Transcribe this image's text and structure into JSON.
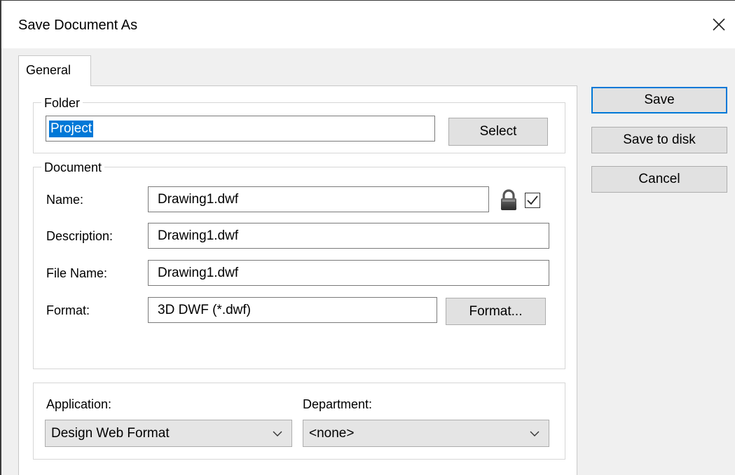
{
  "dialog": {
    "title": "Save Document As",
    "close_icon": "close-icon"
  },
  "tabs": [
    {
      "label": "General",
      "selected": true
    }
  ],
  "folder": {
    "legend": "Folder",
    "value": "Project",
    "select_label": "Select"
  },
  "document": {
    "legend": "Document",
    "name_label": "Name:",
    "name_value": "Drawing1.dwf",
    "lock_icon": "lock-icon",
    "name_checkbox_checked": true,
    "description_label": "Description:",
    "description_value": "Drawing1.dwf",
    "filename_label": "File Name:",
    "filename_value": "Drawing1.dwf",
    "format_label": "Format:",
    "format_value": "3D DWF (*.dwf)",
    "format_button_label": "Format..."
  },
  "classification": {
    "application_label": "Application:",
    "application_value": "Design Web Format",
    "department_label": "Department:",
    "department_value": "<none>"
  },
  "actions": {
    "save_label": "Save",
    "save_to_disk_label": "Save to disk",
    "cancel_label": "Cancel"
  },
  "colors": {
    "accent": "#0078d7",
    "button_face": "#e1e1e1",
    "window_bg": "#f0f0f0"
  }
}
